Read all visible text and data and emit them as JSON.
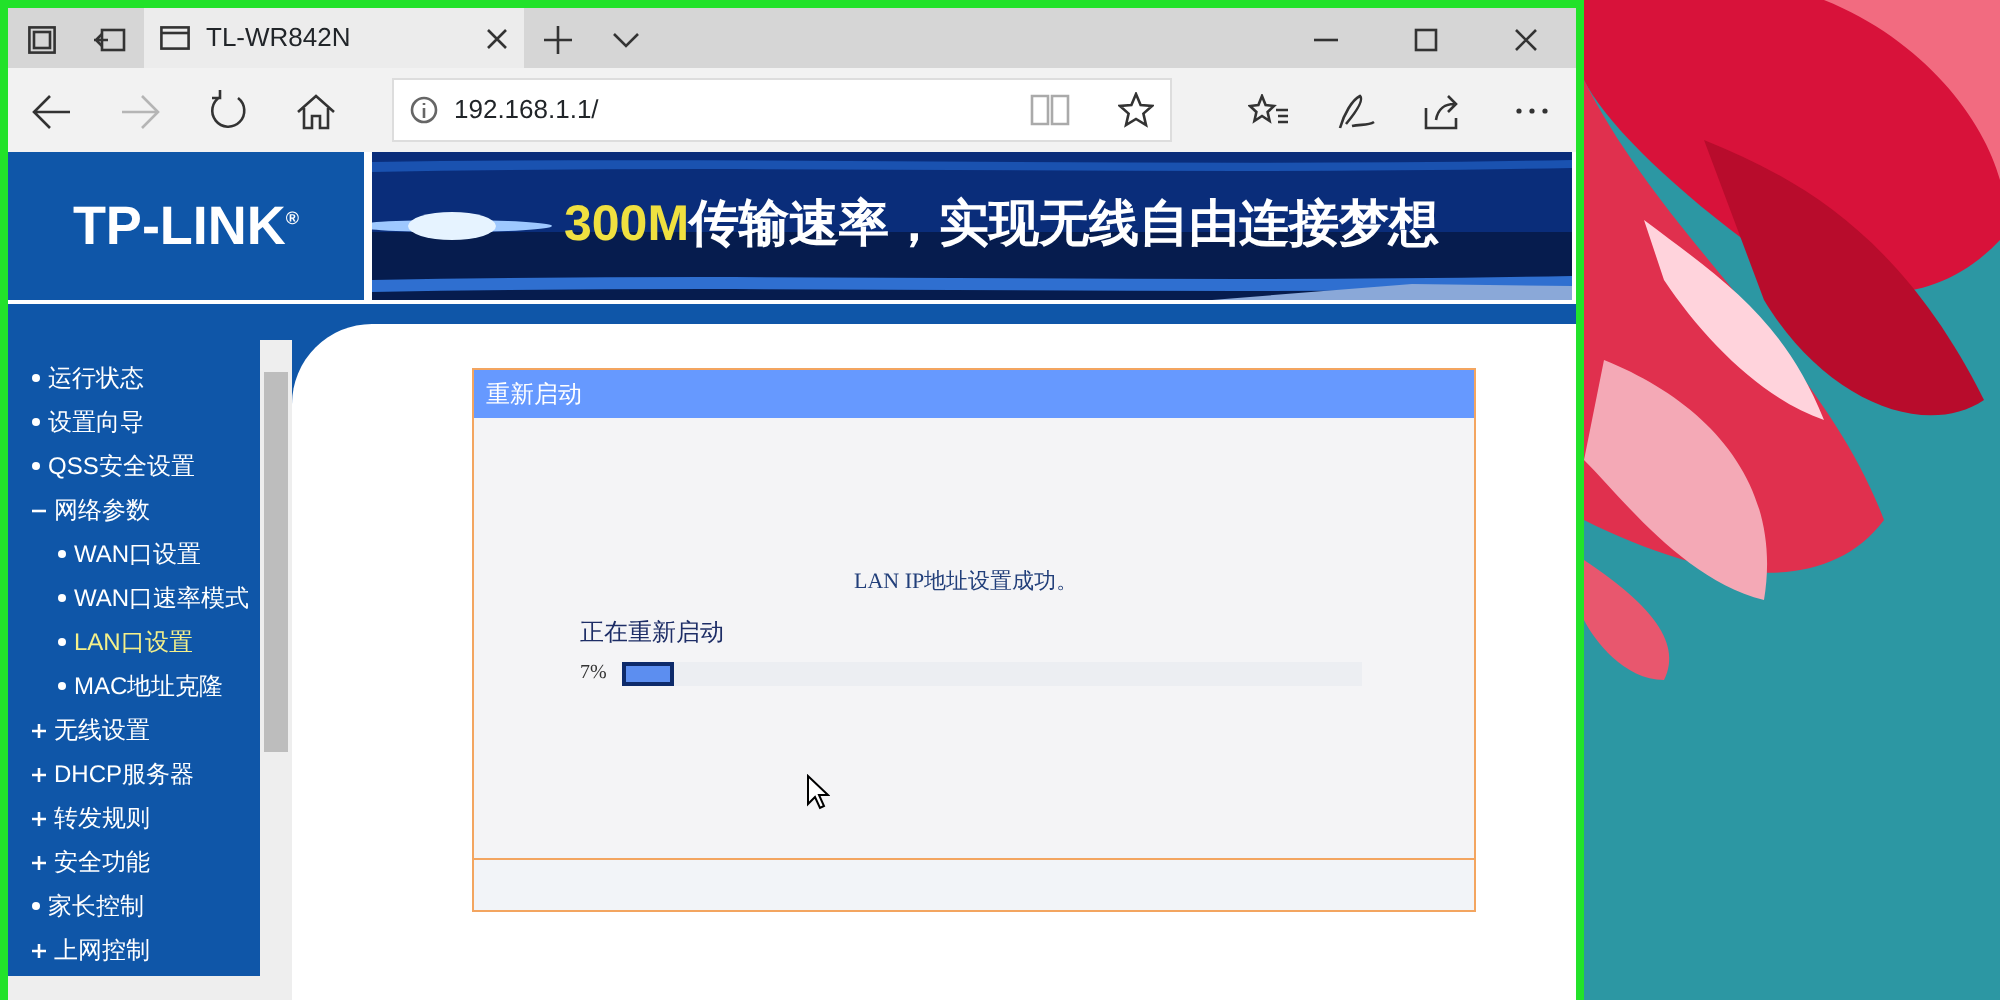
{
  "browser": {
    "tab": {
      "title": "TL-WR842N"
    },
    "forward": {
      "disabled": true
    },
    "address": {
      "url": "192.168.1.1/"
    }
  },
  "router": {
    "logo": "TP-LINK$^{®}$",
    "banner": {
      "highlight": "300M",
      "slogan": "传输速率，实现无线自由连接梦想"
    }
  },
  "menu": [
    {
      "label": "运行状态",
      "kind": "page",
      "selected": false
    },
    {
      "label": "设置向导",
      "kind": "page",
      "selected": false
    },
    {
      "label": "QSS安全设置",
      "kind": "page",
      "selected": false
    },
    {
      "label": "网络参数",
      "kind": "group",
      "expanded": true,
      "selected": false,
      "children": [
        {
          "label": "WAN口设置",
          "kind": "page",
          "selected": false
        },
        {
          "label": "WAN口速率模式",
          "kind": "page",
          "selected": false
        },
        {
          "label": "LAN口设置",
          "kind": "page",
          "selected": true
        },
        {
          "label": "MAC地址克隆",
          "kind": "page",
          "selected": false
        }
      ]
    },
    {
      "label": "无线设置",
      "kind": "group",
      "expanded": false,
      "selected": false
    },
    {
      "label": "DHCP服务器",
      "kind": "group",
      "expanded": false,
      "selected": false
    },
    {
      "label": "转发规则",
      "kind": "group",
      "expanded": false,
      "selected": false
    },
    {
      "label": "安全功能",
      "kind": "group",
      "expanded": false,
      "selected": false
    },
    {
      "label": "家长控制",
      "kind": "page",
      "selected": false
    },
    {
      "label": "上网控制",
      "kind": "group",
      "expanded": false,
      "selected": false
    }
  ],
  "panel": {
    "title": "重新启动",
    "message": "LAN IP地址设置成功。",
    "status": "正在重新启动",
    "progress": {
      "reading": "7%",
      "level": 0.07
    }
  }
}
